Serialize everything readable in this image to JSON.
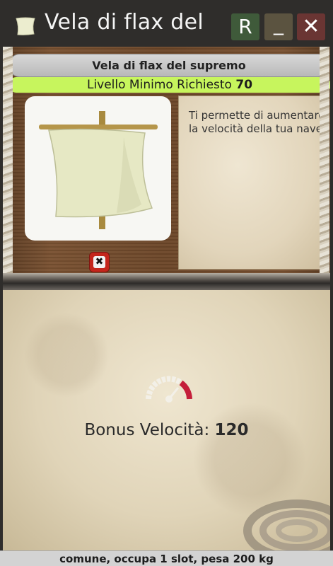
{
  "window": {
    "title": "Vela di flax del",
    "buttons": {
      "r_label": "R",
      "minimize_label": "_",
      "close_label": "✕"
    }
  },
  "item": {
    "name": "Vela di flax del supremo",
    "level_label": "Livello Minimo Richiesto",
    "level_value": "70",
    "icon": "sail-icon",
    "remove_label": "✖",
    "description": "Ti permette di aumentare la velocità della tua nave."
  },
  "stats": {
    "bonus_label": "Bonus Velocità:",
    "bonus_value": "120",
    "icon": "speedometer-icon"
  },
  "footer": {
    "text": "comune, occupa 1 slot, pesa 200 kg"
  },
  "colors": {
    "level_bar": "#c7f55d",
    "remove_button": "#c4261c",
    "speed_accent": "#c41e3a"
  }
}
